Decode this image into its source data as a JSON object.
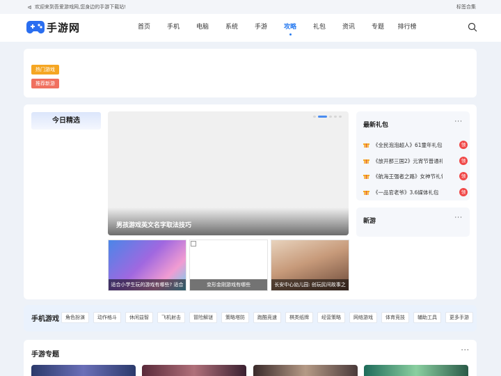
{
  "topbar": {
    "welcome": "欢迎来到吾爱游戏网,您身边的手游下载站!",
    "tags_link": "标签合集"
  },
  "header": {
    "logo_text": "手游网",
    "nav": [
      "首页",
      "手机",
      "电脑",
      "系统",
      "手游",
      "攻略",
      "礼包",
      "资讯",
      "专题",
      "排行榜"
    ],
    "active_nav": "攻略"
  },
  "filters": [
    "热门游戏",
    "推荐新游"
  ],
  "featured": {
    "title": "今日精选",
    "slide_caption": "男孩游戏英文名字取法技巧",
    "thumbs": [
      "适合小学生玩的游戏有哪些? 适合",
      "变形金刚游戏有哪些",
      "长安中心幼儿园: 创玩民间故事之"
    ]
  },
  "gifts": {
    "title": "最新礼包",
    "more": "···",
    "items": [
      {
        "name": "《全民泡泡超人》61童年礼包",
        "badge": "领"
      },
      {
        "name": "《放开那三国2》元宵节普通礼包",
        "badge": "领"
      },
      {
        "name": "《航海王强者之路》女神节礼包",
        "badge": "领"
      },
      {
        "name": "《一品官老爷》3.6媒体礼包",
        "badge": "领"
      }
    ]
  },
  "news": {
    "title": "新游",
    "more": "···"
  },
  "mobile_games": {
    "title": "手机游戏",
    "tags": [
      "角色扮演",
      "动作格斗",
      "休闲益智",
      "飞机射击",
      "冒险解谜",
      "策略塔防",
      "跑酷竞速",
      "棋类纸牌",
      "经营策略",
      "网络游戏",
      "体育竞技",
      "辅助工具",
      "更多手游"
    ]
  },
  "topics": {
    "title": "手游专题",
    "more": "···"
  },
  "colors": {
    "accent": "#2a7cf0",
    "orange": "#f5a623",
    "salmon": "#f0705f",
    "badge": "#f04848"
  }
}
